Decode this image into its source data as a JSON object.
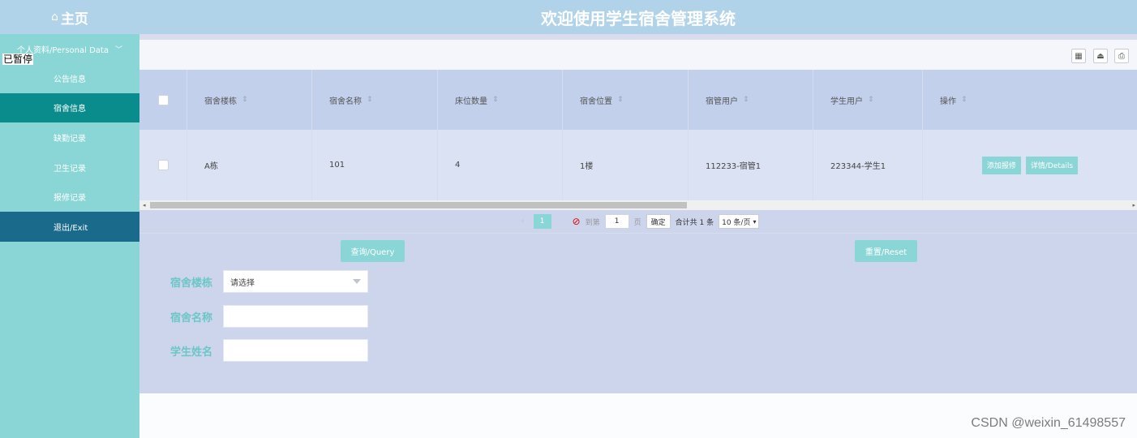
{
  "header": {
    "home_icon": "⌂",
    "home_label": "主页",
    "title": "欢迎使用学生宿舍管理系统"
  },
  "sidebar": {
    "group_label": "个人资料/Personal Data",
    "overlay_text": "已暂停",
    "items": [
      {
        "label": "公告信息"
      },
      {
        "label": "宿舍信息"
      },
      {
        "label": "缺勤记录"
      },
      {
        "label": "卫生记录"
      },
      {
        "label": "报修记录"
      },
      {
        "label": "退出/Exit"
      }
    ]
  },
  "toolbar": {
    "icons": [
      "columns-icon",
      "export-icon",
      "print-icon"
    ]
  },
  "table": {
    "columns": [
      "宿舍楼栋",
      "宿舍名称",
      "床位数量",
      "宿舍位置",
      "宿管用户",
      "学生用户",
      "操作"
    ],
    "rows": [
      {
        "building": "A栋",
        "name": "101",
        "beds": "4",
        "location": "1楼",
        "manager": "112233-宿管1",
        "student": "223344-学生1"
      }
    ],
    "actions": {
      "repair": "添加报修",
      "details": "详情/Details"
    }
  },
  "pager": {
    "current_page": "1",
    "goto_prefix": "到第",
    "goto_value": "1",
    "goto_suffix": "页",
    "confirm": "确定",
    "total": "合计共 1 条",
    "page_size": "10 条/页"
  },
  "form": {
    "query_button": "查询/Query",
    "reset_button": "重置/Reset",
    "building_label": "宿舍楼栋",
    "building_placeholder": "请选择",
    "name_label": "宿舍名称",
    "name_value": "",
    "student_label": "学生姓名",
    "student_value": ""
  },
  "watermark": "CSDN @weixin_61498557",
  "colors": {
    "accent": "#8ad6d6",
    "active": "#0b8c8c",
    "exit": "#1a6a8c",
    "header": "#b0d3ea"
  }
}
